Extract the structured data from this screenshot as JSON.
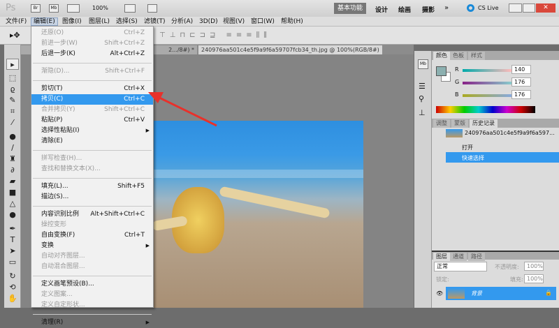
{
  "titlebar": {
    "logo": "Ps",
    "br": "Br",
    "mb": "Mb",
    "zoom": "100%",
    "workspaces": [
      "基本功能",
      "设计",
      "绘画",
      "摄影"
    ],
    "more": "»",
    "cslive": "CS Live"
  },
  "menubar": [
    "文件(F)",
    "编辑(E)",
    "图像(I)",
    "图层(L)",
    "选择(S)",
    "滤镜(T)",
    "分析(A)",
    "3D(D)",
    "视图(V)",
    "窗口(W)",
    "帮助(H)"
  ],
  "doc_tabs": [
    {
      "label": "2.../8#) *"
    },
    {
      "label": "240976aa501c4e5f9a9f6a59707fcb34_th.jpg @ 100%(RGB/8#)"
    }
  ],
  "edit_menu": [
    {
      "label": "还原(O)",
      "shortcut": "Ctrl+Z",
      "disabled": true
    },
    {
      "label": "前进一步(W)",
      "shortcut": "Shift+Ctrl+Z",
      "disabled": true
    },
    {
      "label": "后退一步(K)",
      "shortcut": "Alt+Ctrl+Z"
    },
    {
      "sep": true
    },
    {
      "label": "渐隐(D)...",
      "shortcut": "Shift+Ctrl+F",
      "disabled": true
    },
    {
      "sep": true
    },
    {
      "label": "剪切(T)",
      "shortcut": "Ctrl+X"
    },
    {
      "label": "拷贝(C)",
      "shortcut": "Ctrl+C",
      "highlighted": true
    },
    {
      "label": "合并拷贝(Y)",
      "shortcut": "Shift+Ctrl+C",
      "disabled": true
    },
    {
      "label": "粘贴(P)",
      "shortcut": "Ctrl+V"
    },
    {
      "label": "选择性粘贴(I)",
      "submenu": true
    },
    {
      "label": "清除(E)"
    },
    {
      "sep": true
    },
    {
      "label": "拼写检查(H)...",
      "disabled": true
    },
    {
      "label": "查找和替换文本(X)...",
      "disabled": true
    },
    {
      "sep": true
    },
    {
      "label": "填充(L)...",
      "shortcut": "Shift+F5"
    },
    {
      "label": "描边(S)..."
    },
    {
      "sep": true
    },
    {
      "label": "内容识别比例",
      "shortcut": "Alt+Shift+Ctrl+C"
    },
    {
      "label": "操控变形",
      "disabled": true
    },
    {
      "label": "自由变换(F)",
      "shortcut": "Ctrl+T"
    },
    {
      "label": "变换",
      "submenu": true
    },
    {
      "label": "自动对齐图层...",
      "disabled": true
    },
    {
      "label": "自动混合图层...",
      "disabled": true
    },
    {
      "sep": true
    },
    {
      "label": "定义画笔预设(B)..."
    },
    {
      "label": "定义图案...",
      "disabled": true
    },
    {
      "label": "定义自定形状...",
      "disabled": true
    },
    {
      "sep": true
    },
    {
      "label": "清理(R)",
      "submenu": true
    }
  ],
  "color_panel": {
    "tabs": [
      "颜色",
      "色板",
      "样式"
    ],
    "r_label": "R",
    "g_label": "G",
    "b_label": "B",
    "r": "140",
    "g": "176",
    "b": "176",
    "foreground": "#8cb0b0"
  },
  "history_panel": {
    "tabs": [
      "调整",
      "蒙版",
      "历史记录"
    ],
    "snapshot": "240976aa501c4e5f9a9f6a597...",
    "items": [
      "打开",
      "快速选择"
    ]
  },
  "layers_panel": {
    "tabs": [
      "图层",
      "通道",
      "路径"
    ],
    "blend_mode": "正常",
    "opacity_label": "不透明度:",
    "opacity": "100%",
    "lock_label": "锁定:",
    "fill_label": "填充:",
    "fill": "100%",
    "layer": "背景"
  },
  "colors": {
    "highlight": "#3399ee",
    "arrow": "#e8312b"
  }
}
